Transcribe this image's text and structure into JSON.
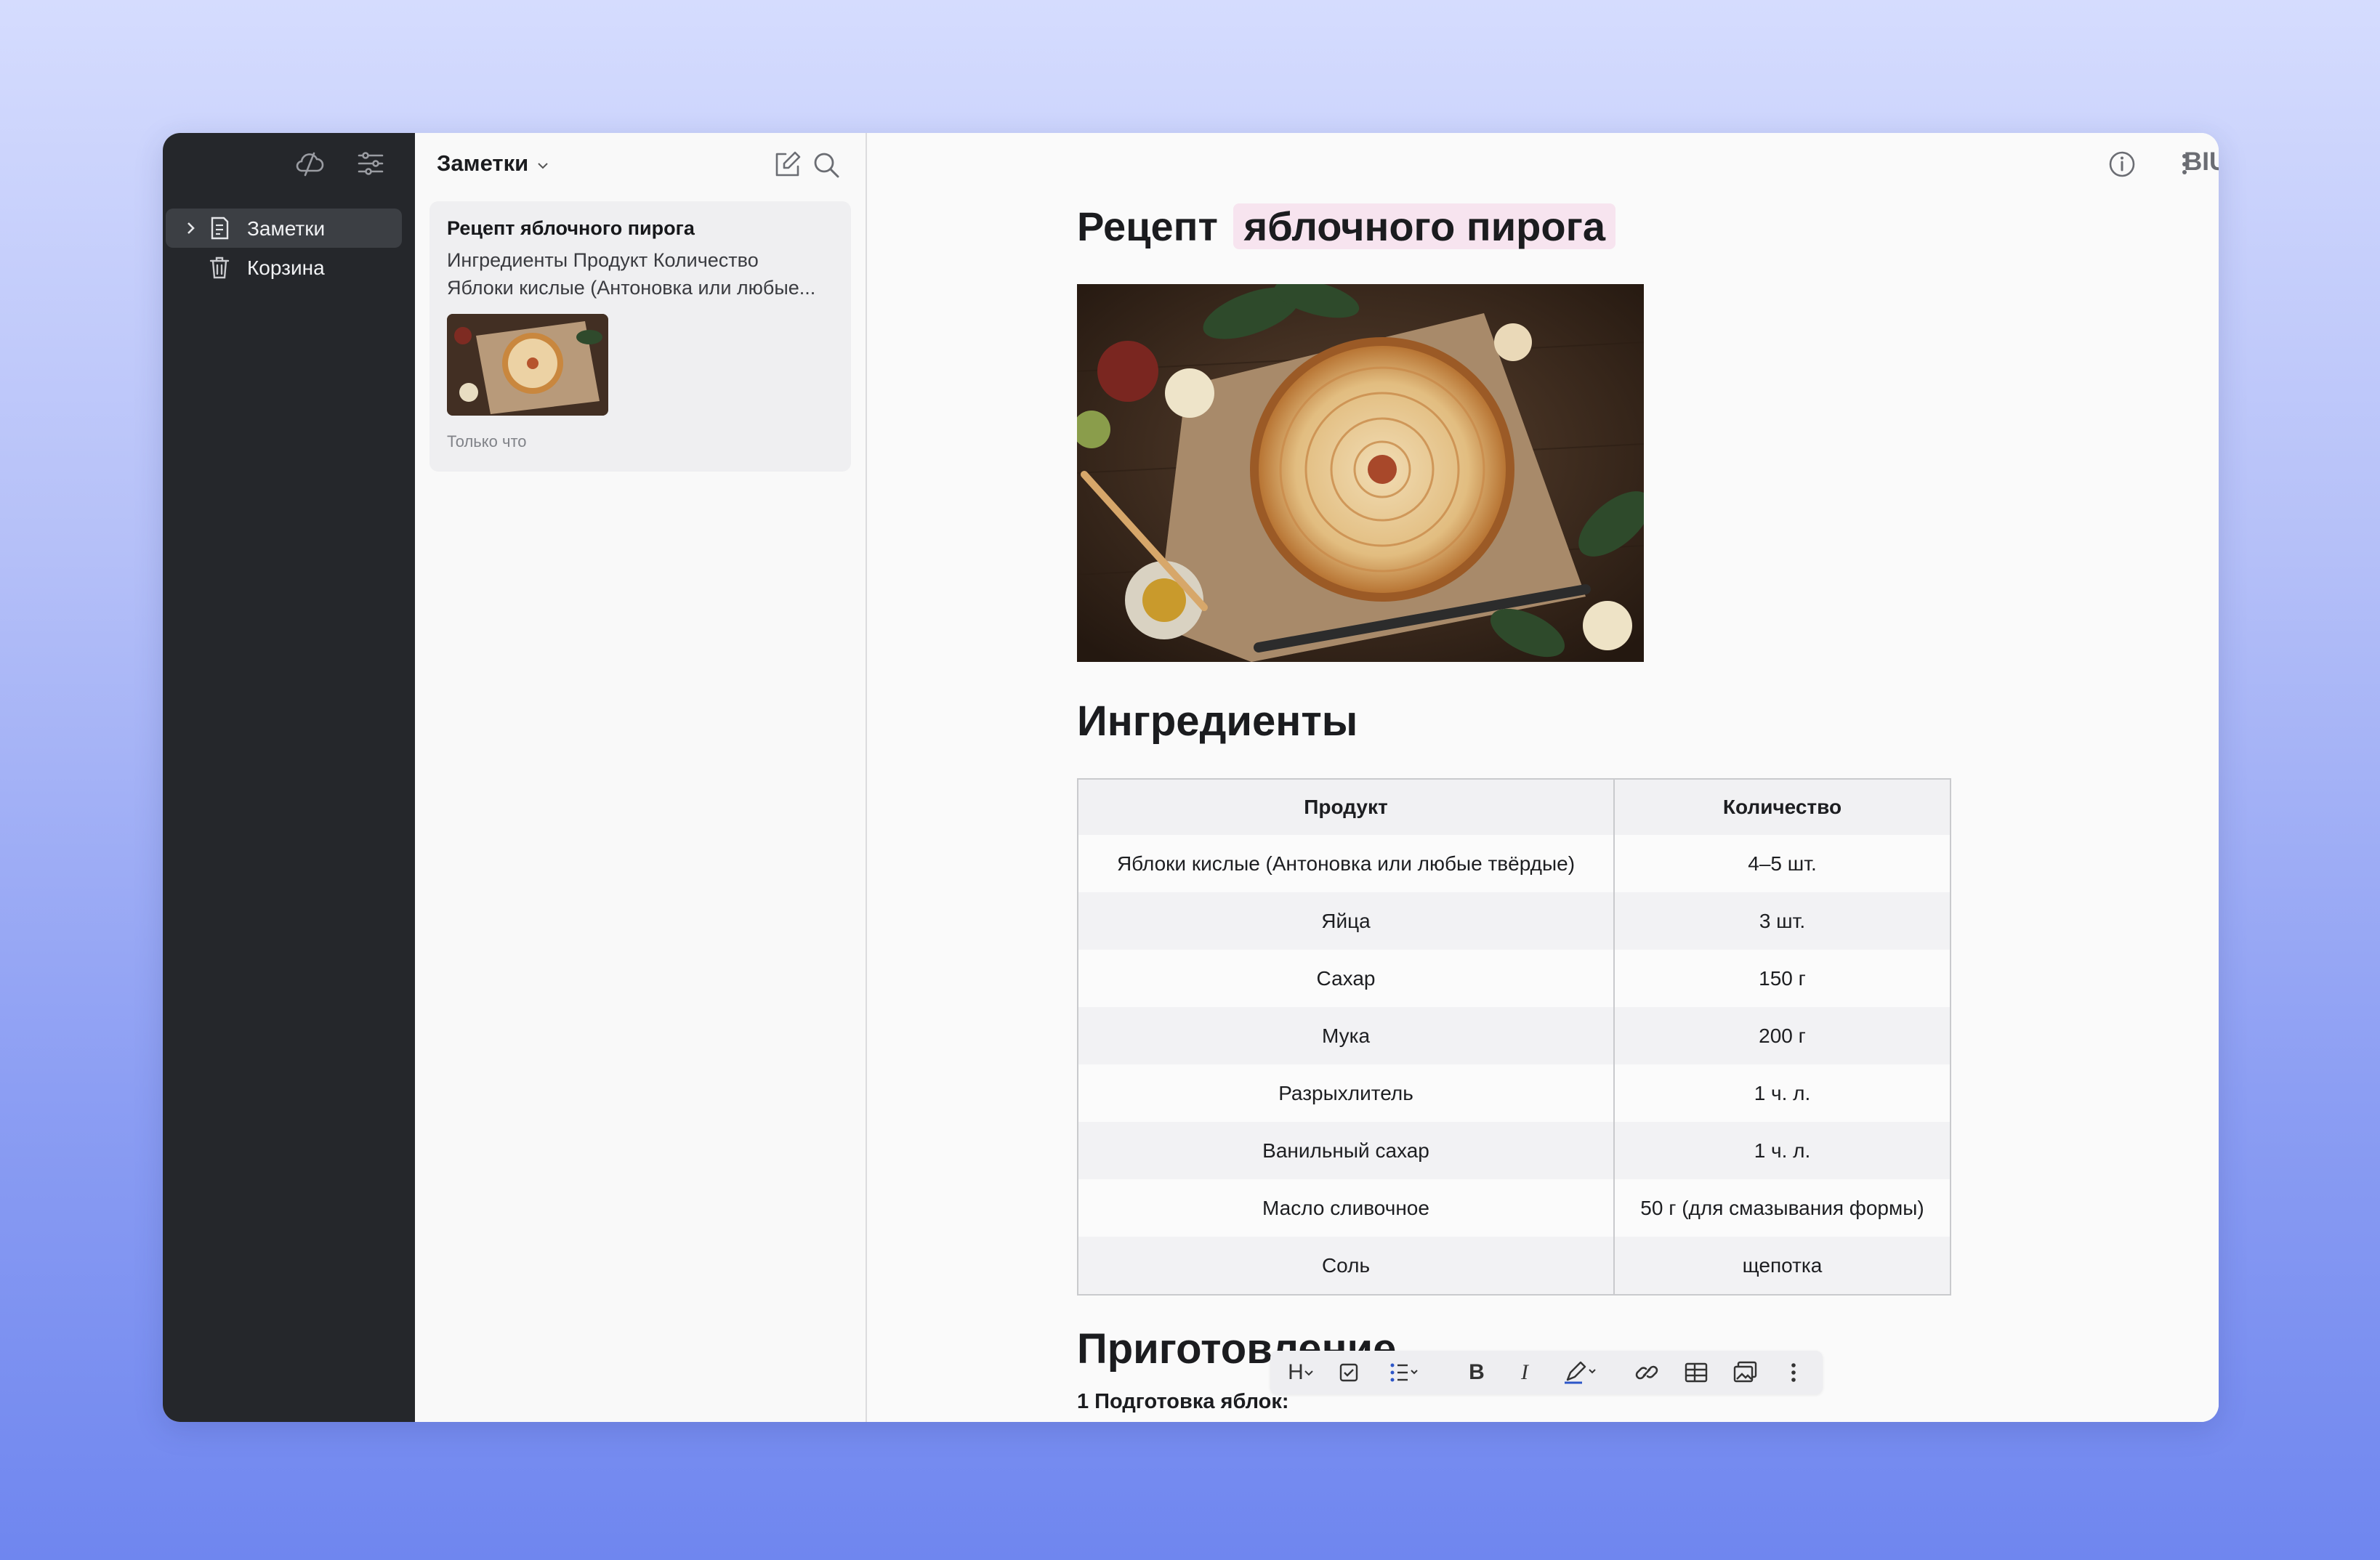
{
  "sidebar": {
    "items": [
      {
        "label": "Заметки",
        "icon": "note-icon",
        "active": true
      },
      {
        "label": "Корзина",
        "icon": "trash-icon",
        "active": false
      }
    ]
  },
  "notelist": {
    "title": "Заметки",
    "note": {
      "title": "Рецепт яблочного пирога",
      "line1": "Ингредиенты Продукт Количество",
      "line2": "Яблоки кислые (Антоновка или любые...",
      "time": "Только что"
    }
  },
  "editor": {
    "format_label": "BIU",
    "title_plain": "Рецепт",
    "title_highlight": "яблочного пирога",
    "h2_ingredients": "Ингредиенты",
    "table": {
      "headers": [
        "Продукт",
        "Количество"
      ],
      "rows": [
        [
          "Яблоки кислые (Антоновка или любые твёрдые)",
          "4–5 шт."
        ],
        [
          "Яйца",
          "3 шт."
        ],
        [
          "Сахар",
          "150 г"
        ],
        [
          "Мука",
          "200 г"
        ],
        [
          "Разрыхлитель",
          "1 ч. л."
        ],
        [
          "Ванильный сахар",
          "1 ч. л."
        ],
        [
          "Масло сливочное",
          "50 г (для смазывания формы)"
        ],
        [
          "Соль",
          "щепотка"
        ]
      ]
    },
    "h2_preparation": "Приготовление",
    "step1": "1 Подготовка яблок:",
    "toolbar": {
      "heading_label": "H",
      "bold_label": "B",
      "italic_label": "I"
    }
  }
}
